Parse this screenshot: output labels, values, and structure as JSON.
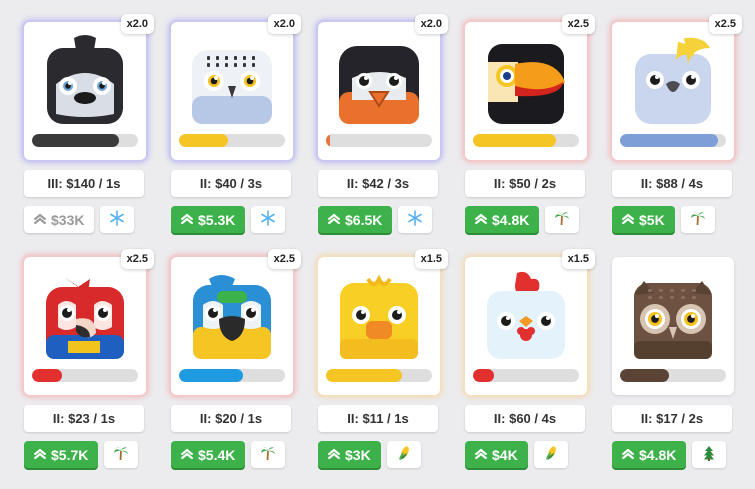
{
  "cards": [
    {
      "name": "penguin",
      "tier": "III: $140 / 1s",
      "multiplier": "x2.0",
      "progress": 0.82,
      "bar_color": "#3a3a3a",
      "glow": "blue",
      "price": "$33K",
      "affordable": false,
      "biome": "snowflake-icon"
    },
    {
      "name": "snowy-owl",
      "tier": "II: $40 / 3s",
      "multiplier": "x2.0",
      "progress": 0.46,
      "bar_color": "#f5c623",
      "glow": "blue",
      "price": "$5.3K",
      "affordable": true,
      "biome": "snowflake-icon"
    },
    {
      "name": "puffin",
      "tier": "II: $42 / 3s",
      "multiplier": "x2.0",
      "progress": 0.02,
      "bar_color": "#e6763a",
      "glow": "blue",
      "price": "$6.5K",
      "affordable": true,
      "biome": "snowflake-icon"
    },
    {
      "name": "toucan",
      "tier": "II: $50 / 2s",
      "multiplier": "x2.5",
      "progress": 0.78,
      "bar_color": "#f5c623",
      "glow": "red",
      "price": "$4.8K",
      "affordable": true,
      "biome": "palm-icon"
    },
    {
      "name": "cockatoo",
      "tier": "II: $88 / 4s",
      "multiplier": "x2.5",
      "progress": 0.92,
      "bar_color": "#7d9ed6",
      "glow": "red",
      "price": "$5K",
      "affordable": true,
      "biome": "palm-icon"
    },
    {
      "name": "scarlet-macaw",
      "tier": "II: $23 / 1s",
      "multiplier": "x2.5",
      "progress": 0.28,
      "bar_color": "#e2302f",
      "glow": "red",
      "price": "$5.7K",
      "affordable": true,
      "biome": "palm-icon"
    },
    {
      "name": "blue-gold-macaw",
      "tier": "II: $20 / 1s",
      "multiplier": "x2.5",
      "progress": 0.6,
      "bar_color": "#1e9be0",
      "glow": "red",
      "price": "$5.4K",
      "affordable": true,
      "biome": "palm-icon"
    },
    {
      "name": "chick",
      "tier": "II: $11 / 1s",
      "multiplier": "x1.5",
      "progress": 0.72,
      "bar_color": "#f5c623",
      "glow": "gold",
      "price": "$3K",
      "affordable": true,
      "biome": "corn-icon"
    },
    {
      "name": "chicken",
      "tier": "II: $60 / 4s",
      "multiplier": "x1.5",
      "progress": 0.2,
      "bar_color": "#e2302f",
      "glow": "gold",
      "price": "$4K",
      "affordable": true,
      "biome": "corn-icon"
    },
    {
      "name": "brown-owl",
      "tier": "II: $17 / 2s",
      "multiplier": "",
      "progress": 0.46,
      "bar_color": "#5b4336",
      "glow": "none",
      "price": "$4.8K",
      "affordable": true,
      "biome": "tree-icon"
    }
  ]
}
